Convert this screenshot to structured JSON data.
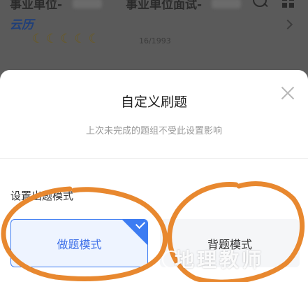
{
  "background": {
    "tab_1": "事业单位-",
    "tab_2": "事业单位面试-",
    "logo_text": "云历",
    "stars": [
      "☾",
      "☾",
      "☾",
      "☾",
      "☾"
    ],
    "progress": "16/1993"
  },
  "dialog": {
    "title": "自定义刷题",
    "subtitle": "上次未完成的题组不受此设置影响",
    "section_label": "设置出题模式",
    "modes": [
      {
        "label": "做题模式",
        "selected": true
      },
      {
        "label": "背题模式",
        "selected": false
      }
    ]
  },
  "watermark": "地理教师",
  "colors": {
    "accent": "#3d7cf2",
    "annotation": "#e8882f"
  }
}
